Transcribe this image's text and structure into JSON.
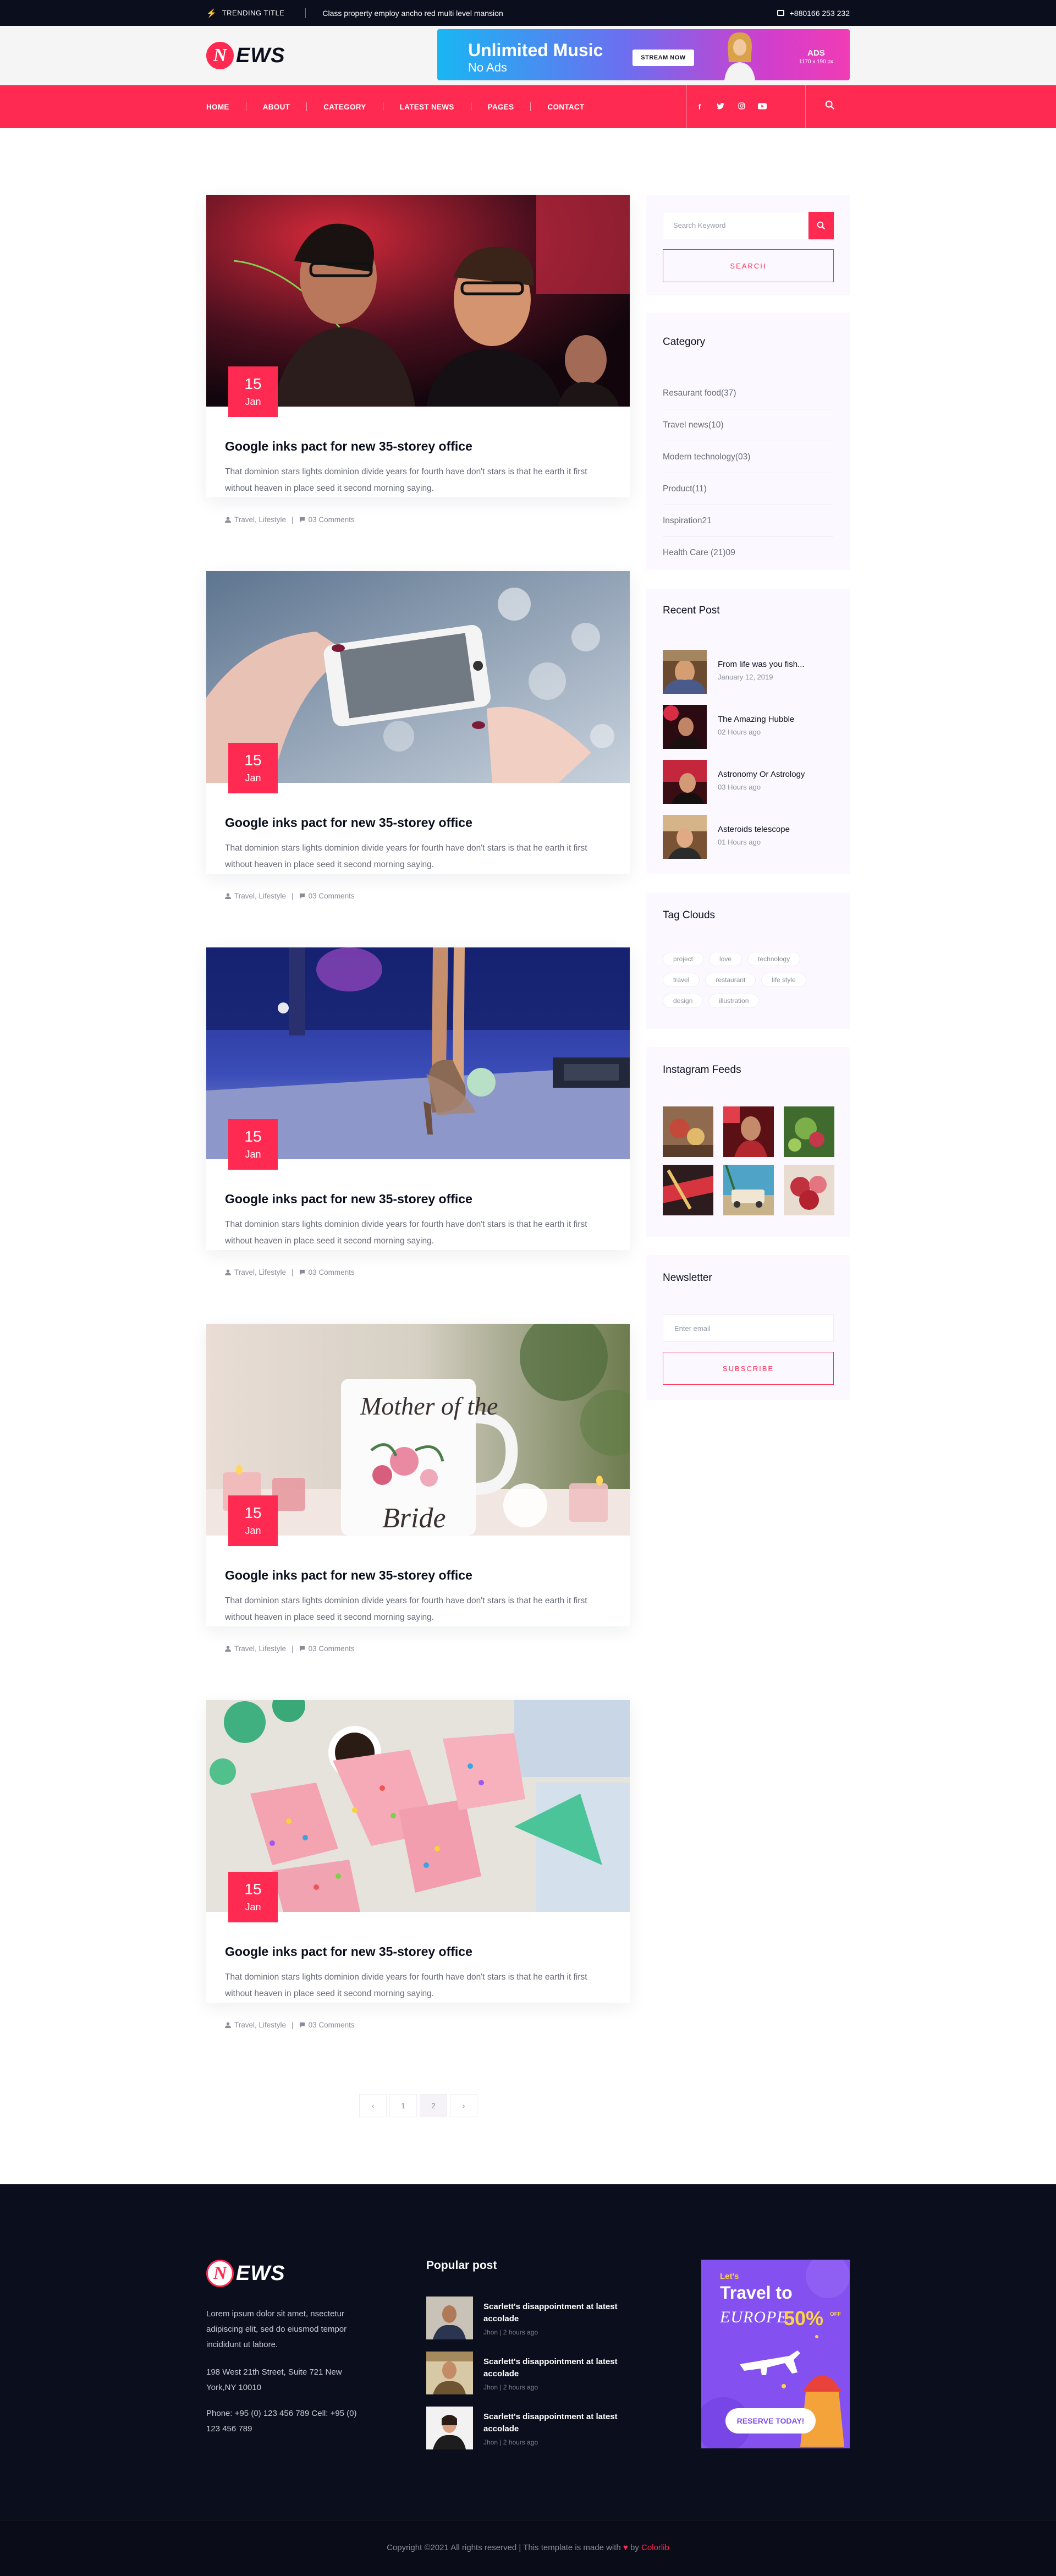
{
  "topbar": {
    "trending_label": "TRENDING TITLE",
    "trending_text": "Class property employ ancho red multi level mansion",
    "phone": "+880166 253 232"
  },
  "header": {
    "logo_n": "N",
    "logo_rest": "EWS",
    "ad": {
      "title": "Unlimited Music",
      "subtitle": "No Ads",
      "button": "STREAM NOW",
      "tag": "ADS",
      "tag_size": "1170 x 190 px"
    }
  },
  "nav": {
    "links": [
      "HOME",
      "ABOUT",
      "CATEGORY",
      "LATEST NEWS",
      "PAGES",
      "CONTACT"
    ],
    "socials": [
      "f",
      "t",
      "i",
      "y"
    ],
    "social_names": [
      "facebook-icon",
      "twitter-icon",
      "instagram-icon",
      "youtube-icon"
    ]
  },
  "posts": [
    {
      "day": "15",
      "month": "Jan",
      "title": "Google inks pact for new 35-storey office",
      "excerpt": "That dominion stars lights dominion divide years for fourth have don't stars is that he earth it first without heaven in place seed it second morning saying.",
      "categories": "Travel, Lifestyle",
      "comments": "03 Comments"
    },
    {
      "day": "15",
      "month": "Jan",
      "title": "Google inks pact for new 35-storey office",
      "excerpt": "That dominion stars lights dominion divide years for fourth have don't stars is that he earth it first without heaven in place seed it second morning saying.",
      "categories": "Travel, Lifestyle",
      "comments": "03 Comments"
    },
    {
      "day": "15",
      "month": "Jan",
      "title": "Google inks pact for new 35-storey office",
      "excerpt": "That dominion stars lights dominion divide years for fourth have don't stars is that he earth it first without heaven in place seed it second morning saying.",
      "categories": "Travel, Lifestyle",
      "comments": "03 Comments"
    },
    {
      "day": "15",
      "month": "Jan",
      "title": "Google inks pact for new 35-storey office",
      "excerpt": "That dominion stars lights dominion divide years for fourth have don't stars is that he earth it first without heaven in place seed it second morning saying.",
      "categories": "Travel, Lifestyle",
      "comments": "03 Comments"
    },
    {
      "day": "15",
      "month": "Jan",
      "title": "Google inks pact for new 35-storey office",
      "excerpt": "That dominion stars lights dominion divide years for fourth have don't stars is that he earth it first without heaven in place seed it second morning saying.",
      "categories": "Travel, Lifestyle",
      "comments": "03 Comments"
    }
  ],
  "pagination": {
    "prev": "‹",
    "pages": [
      "1",
      "2"
    ],
    "active": "2",
    "next": "›"
  },
  "sidebar": {
    "search": {
      "placeholder": "Search Keyword",
      "button": "SEARCH"
    },
    "category": {
      "title": "Category",
      "items": [
        "Resaurant food(37)",
        "Travel news(10)",
        "Modern technology(03)",
        "Product(11)",
        "Inspiration21",
        "Health Care (21)09"
      ]
    },
    "recent": {
      "title": "Recent Post",
      "items": [
        {
          "title": "From life was you fish...",
          "date": "January 12, 2019"
        },
        {
          "title": "The Amazing Hubble",
          "date": "02 Hours ago"
        },
        {
          "title": "Astronomy Or Astrology",
          "date": "03 Hours ago"
        },
        {
          "title": "Asteroids telescope",
          "date": "01 Hours ago"
        }
      ]
    },
    "tags": {
      "title": "Tag Clouds",
      "items": [
        "project",
        "love",
        "technology",
        "travel",
        "restaurant",
        "life style",
        "design",
        "illustration"
      ]
    },
    "instagram": {
      "title": "Instagram Feeds"
    },
    "newsletter": {
      "title": "Newsletter",
      "placeholder": "Enter email",
      "button": "SUBSCRIBE"
    }
  },
  "footer": {
    "about": "Lorem ipsum dolor sit amet, nsectetur adipiscing elit, sed do eiusmod tempor incididunt ut labore.",
    "address": "198 West 21th Street, Suite 721 New York,NY 10010",
    "phone": "Phone: +95 (0) 123 456 789 Cell: +95 (0) 123 456 789",
    "popular_title": "Popular post",
    "popular": [
      {
        "title": "Scarlett's disappointment at latest accolade",
        "meta": "Jhon | 2 hours ago"
      },
      {
        "title": "Scarlett's disappointment at latest accolade",
        "meta": "Jhon | 2 hours ago"
      },
      {
        "title": "Scarlett's disappointment at latest accolade",
        "meta": "Jhon | 2 hours ago"
      }
    ],
    "promo": {
      "lets": "Let's",
      "travel": "Travel to",
      "europe": "EUROPE",
      "pct": "50%",
      "off": "OFF",
      "button": "RESERVE TODAY!"
    }
  },
  "copyright": {
    "text": "Copyright ©2021 All rights reserved | This template is made with",
    "by": "by",
    "brand": "Colorlib"
  },
  "colors": {
    "accent": "#ff2a52",
    "dark": "#0b0e1c",
    "sidebar_bg": "#fbf9ff",
    "promo": "#8451f0"
  }
}
